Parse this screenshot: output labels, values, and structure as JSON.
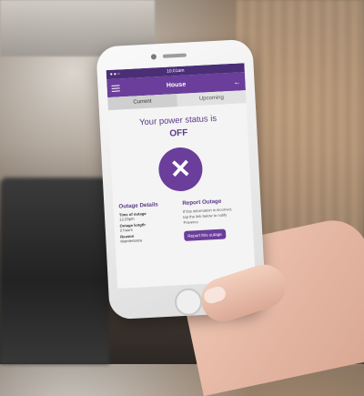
{
  "status_bar": {
    "time": "10:01am",
    "dots": "●●○"
  },
  "nav": {
    "title": "House",
    "back_icon": "arrow-left-icon",
    "menu_icon": "hamburger-icon"
  },
  "tabs": [
    {
      "label": "Current",
      "active": true
    },
    {
      "label": "Upcoming",
      "active": false
    }
  ],
  "headline": "Your power status is",
  "status": "OFF",
  "status_icon": "x-icon",
  "outage_details": {
    "title": "Outage Details",
    "time_label": "Time of outage",
    "time_value": "12:23pm",
    "length_label": "Outage length",
    "length_value": "2 hours",
    "reason_label": "Reason",
    "reason_value": "Maintenance"
  },
  "report_outage": {
    "title": "Report Outage",
    "text": "If this information is incorrect, tap the link below to notify Powerco",
    "button_label": "Report this outage"
  },
  "colors": {
    "primary": "#6a3e9a",
    "primary_dark": "#4a2f77"
  }
}
